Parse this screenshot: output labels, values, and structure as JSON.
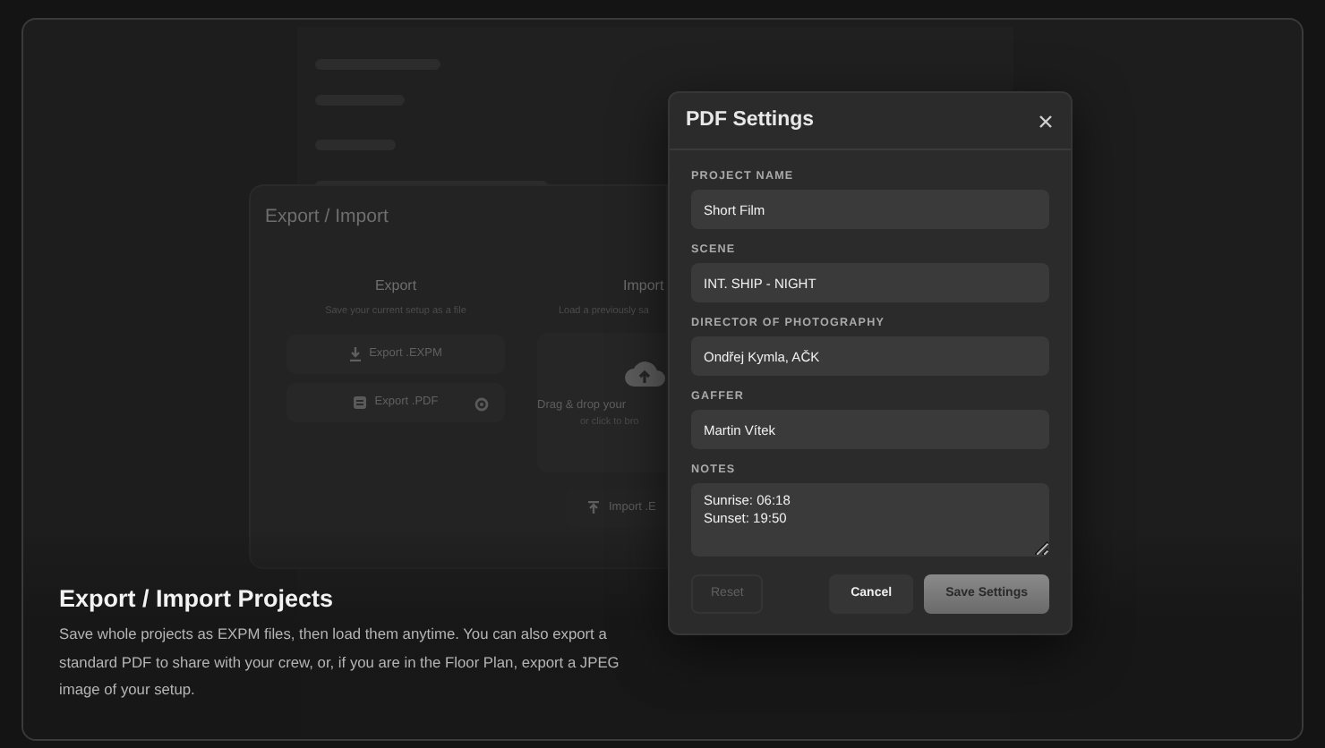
{
  "background_panel": {
    "title": "Export / Import",
    "export": {
      "heading": "Export",
      "subtitle": "Save your current setup as a file",
      "buttons": [
        {
          "label": "Export .EXPM",
          "kind": "expm",
          "has_settings": false
        },
        {
          "label": "Export .PDF",
          "kind": "pdf",
          "has_settings": true
        }
      ]
    },
    "import": {
      "heading": "Import",
      "subtitle": "Load a previously sa",
      "dropzone": {
        "text": "Drag & drop your",
        "hint": "or click to bro"
      },
      "button": "Import .E"
    }
  },
  "dialog": {
    "title": "PDF Settings",
    "fields": [
      {
        "label": "PROJECT NAME",
        "value": "Short Film",
        "kind": "input"
      },
      {
        "label": "SCENE",
        "value": "INT. SHIP - NIGHT",
        "kind": "input"
      },
      {
        "label": "DIRECTOR OF PHOTOGRAPHY",
        "value": "Ondřej Kymla, AČK",
        "kind": "input"
      },
      {
        "label": "GAFFER",
        "value": "Martin Vítek",
        "kind": "input"
      },
      {
        "label": "NOTES",
        "value": "Sunrise: 06:18\nSunset: 19:50",
        "kind": "textarea"
      }
    ],
    "buttons": [
      {
        "label": "Reset",
        "kind": "reset",
        "disabled": true
      },
      {
        "label": "Cancel",
        "kind": "secondary",
        "disabled": false
      },
      {
        "label": "Save Settings",
        "kind": "primary",
        "disabled": false
      }
    ]
  },
  "caption": {
    "title": "Export / Import Projects",
    "text": "Save whole projects as EXPM files, then load them anytime. You can also export a standard PDF to share with your crew, or, if you are in the Floor Plan, export a JPEG image of your setup."
  }
}
